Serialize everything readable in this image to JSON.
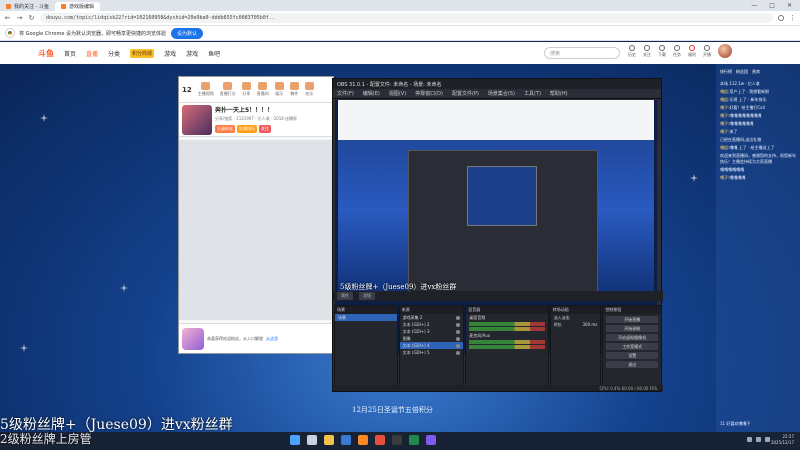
{
  "browser": {
    "tabs": [
      {
        "label": "我的关注 - 斗鱼",
        "active": false
      },
      {
        "label": "游戏版编辑",
        "active": true
      }
    ],
    "url": "douyu.com/topic/lidqisk22?rid=102160958&dyshid=20e9ba0-dddb655fc0083705b0f.."
  },
  "infobar": {
    "text": "将 Google Chrome 设为默认浏览器，即可畅享更快捷的浏览体验",
    "button": "设为默认"
  },
  "site": {
    "logo": "斗鱼",
    "nav": [
      {
        "label": "首页",
        "active": false
      },
      {
        "label": "直播",
        "active": true
      },
      {
        "label": "分类",
        "active": false
      },
      {
        "label": "游戏",
        "active": false
      },
      {
        "label": "游戏",
        "active": false
      },
      {
        "label": "鱼吧",
        "active": false
      }
    ],
    "nav_badge": "积分商城",
    "search_placeholder": "搜索",
    "icons": [
      {
        "name": "history",
        "label": "历史"
      },
      {
        "name": "follow",
        "label": "关注"
      },
      {
        "name": "download",
        "label": "下载"
      },
      {
        "name": "task",
        "label": "任务"
      },
      {
        "name": "gift",
        "label": "福利"
      },
      {
        "name": "live",
        "label": "开播"
      }
    ]
  },
  "room": {
    "followers": "12",
    "toolbar": [
      "主播视频",
      "直播打分",
      "分享",
      "直播间",
      "娱乐",
      "稿件",
      "欢乐"
    ],
    "title": "奔扑一天上5！！！！",
    "stats": "分享/抽奖 · 1121997 · 亿人收 · 2018 送爆款",
    "tags": [
      {
        "text": "五级粉丝",
        "color": "#ff7a45"
      },
      {
        "text": "礼物排行",
        "color": "#ff9f1a"
      },
      {
        "text": "关注",
        "color": "#f15a5a"
      }
    ],
    "footer_text": "恭喜获得欢迎粉丝，从入口解锁",
    "footer_link": "从这里"
  },
  "obs": {
    "title": "OBS 31.0.1 - 配置文件: 未命名 - 场景: 未命名",
    "menu": [
      "文件(F)",
      "编辑(E)",
      "视图(V)",
      "停靠窗口(D)",
      "配置文件(P)",
      "场景集合(S)",
      "工具(T)",
      "帮助(H)"
    ],
    "overlay": "5级粉丝牌+（Juese09）进vx粉丝群",
    "ctrl": [
      "属性",
      "滤镜"
    ],
    "scenes": {
      "title": "场景",
      "items": [
        "场景"
      ]
    },
    "sources": {
      "title": "来源",
      "items": [
        "游戏采集 2",
        "文本 (GDI+) 2",
        "文本 (GDI+) 3",
        "图像",
        "文本 (GDI+) 4",
        "文本 (GDI+) 5"
      ]
    },
    "mixer": {
      "title": "混音器",
      "channels": [
        "桌面音频",
        "麦克风/Aux"
      ]
    },
    "transitions": {
      "title": "转场动画",
      "type": "淡入淡出",
      "duration_label": "时长",
      "duration": "300 ms"
    },
    "controls": {
      "title": "控制按钮",
      "buttons": [
        "开始直播",
        "开始录制",
        "开启虚拟摄像机",
        "工作室模式",
        "设置",
        "退出"
      ]
    },
    "status": "CPU: 0.4%   60.00 / 60.00 FPS"
  },
  "chat": {
    "tabs": [
      "排行榜",
      "粉丝团",
      "贵宾"
    ],
    "lines": [
      {
        "user": "",
        "text": "本场 112.1w · 亿人收"
      },
      {
        "user": "嘎姐:",
        "text": "用户上了 · 我想看新鲜"
      },
      {
        "user": "嘎姐:",
        "text": "乐视 上了 · 新年快乐"
      },
      {
        "user": "嘎子:",
        "text": "好看！给主播打Call"
      },
      {
        "user": "嘎子:",
        "text": "嘎嘎嘎嘎嘎嘎嘎嘎"
      },
      {
        "user": "嘎子:",
        "text": "嘎嘎嘎嘎嘎嘎"
      },
      {
        "user": "嘎子:",
        "text": "来了"
      },
      {
        "user": "",
        "text": "已经在直播间,送出礼物"
      },
      {
        "user": "嘎姐:",
        "text": "嘎嘎 上了 · 给主播送上了"
      },
      {
        "user": "",
        "text": "欢迎来到直播间，感谢您的支持，祝您新年快乐！主播会持续为大家直播"
      },
      {
        "user": "",
        "text": "嘎嘎嘎嘎嘎嘎"
      },
      {
        "user": "嘎子:",
        "text": "嘎嘎嘎嘎"
      }
    ],
    "input_hint": "11 好喜欢嘎嘎子"
  },
  "banner": {
    "line1": "5级粉丝牌+（Juese09）进vx粉丝群",
    "line2": "2级粉丝牌上房管",
    "mid": "12月25日圣诞节五倍积分"
  },
  "taskbar": {
    "time": "22:57",
    "date": "2025/12/17"
  }
}
